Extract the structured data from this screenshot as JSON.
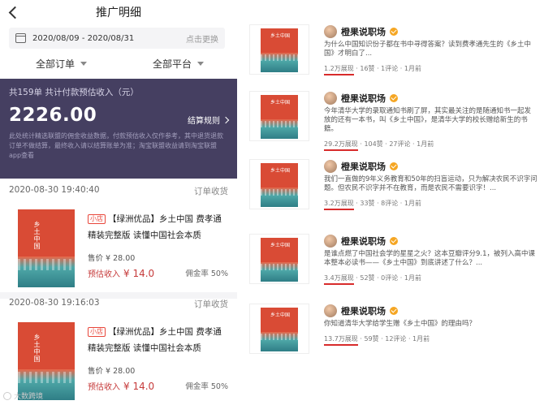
{
  "left": {
    "title": "推广明细",
    "date_range": "2020/08/09 - 2020/08/31",
    "date_change": "点击更换",
    "filter_orders": "全部订单",
    "filter_platforms": "全部平台",
    "summary": {
      "stats": "共159单 共计付款预估收入（元）",
      "amount": "2226.00",
      "rule_link": "结算规则",
      "note": "此处统计精选联盟的佣金收益数据，付款预估收入仅作参考，其中退货退款订单不做结算，最终收入请以结算账单为准；淘宝联盟收益请到淘宝联盟app查看"
    },
    "orders": [
      {
        "time": "2020-08-30 19:40:40",
        "status": "订单收货",
        "tag": "小店",
        "title": "【绿洲优品】乡土中国 费孝通 精装完整版 读懂中国社会本质",
        "price": "售价 ¥ 28.00",
        "est_label": "预估收入",
        "est_value": "¥ 14.0",
        "commission": "佣金率 50%",
        "cover_title": "乡土中国"
      },
      {
        "time": "2020-08-30 19:16:03",
        "status": "订单收货",
        "tag": "小店",
        "title": "【绿洲优品】乡土中国 费孝通 精装完整版 读懂中国社会本质",
        "price": "售价 ¥ 28.00",
        "est_label": "预估收入",
        "est_value": "¥ 14.0",
        "commission": "佣金率 50%",
        "cover_title": "乡土中国"
      }
    ],
    "watermark": "大数跨境"
  },
  "right": {
    "videos": [
      {
        "user": "橙果说职场",
        "desc": "为什么中国知识份子都在书中寻得答案？读到费孝通先生的《乡土中国》才明白了...",
        "views": "1.2万展现",
        "rest": " · 16赞 · 1评论 · 1月前",
        "cover": "乡土中国"
      },
      {
        "user": "橙果说职场",
        "desc": "今年清华大学的录取通知书刷了屏，其实最关注的是随通知书一起发放的还有一本书，叫《乡土中国》，是清华大学的校长赠给新生的书籍。",
        "views": "29.2万展现",
        "rest": " · 104赞 · 27评论 · 1月前",
        "cover": "乡土中国"
      },
      {
        "user": "橙果说职场",
        "desc": "我们一直做的9年义务教育和50年的扫盲运动，只为解决农民不识字问题。但农民不识字并不在教育，而是农民不需要识字！...",
        "views": "3.2万展现",
        "rest": " · 33赞 · 8评论 · 1月前",
        "cover": "乡土中国"
      },
      {
        "user": "橙果说职场",
        "desc": "是谁点燃了中国社会学的星星之火？这本豆瓣评分9.1，被列入高中课本整本必读书——《乡土中国》到底讲述了什么？...",
        "views": "3.4万展现",
        "rest": " · 52赞 · 0评论 · 1月前",
        "cover": "乡土中国"
      },
      {
        "user": "橙果说职场",
        "desc": "你知道清华大学给学生赠《乡土中国》的理由吗？",
        "views": "13.7万展现",
        "rest": " · 59赞 · 12评论 · 1月前",
        "cover": "乡土中国"
      }
    ]
  }
}
